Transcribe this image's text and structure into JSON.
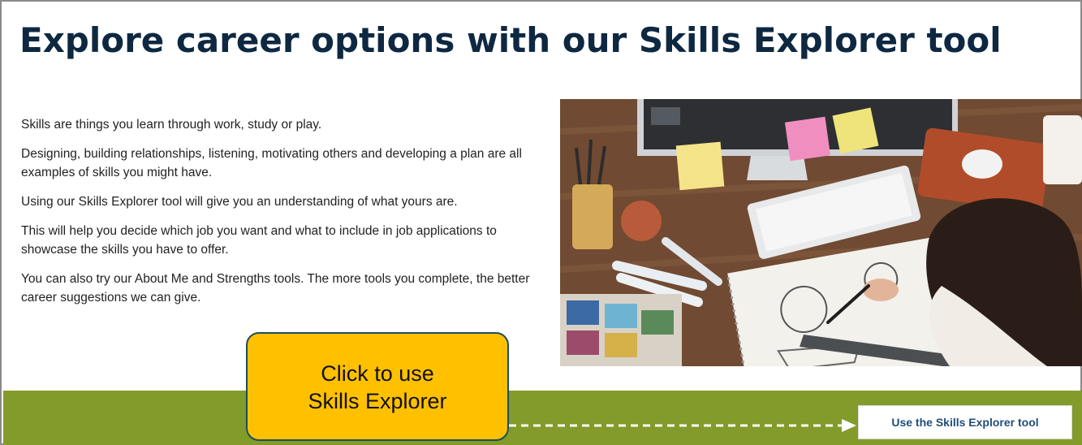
{
  "page": {
    "heading": "Explore career options with our Skills Explorer tool",
    "paragraphs": [
      "Skills are things you learn through work, study or play.",
      "Designing, building relationships, listening, motivating others and developing a plan are all examples of skills you might have.",
      "Using our Skills Explorer tool will give you an understanding of what yours are.",
      "This will help you decide which job you want and what to include in job applications to showcase the skills you have to offer.",
      "You can also try our About Me and Strengths tools. The more tools you complete, the better career suggestions we can give."
    ]
  },
  "image": {
    "subject": "person sketching designs at a wooden desk with keyboard, monitor, sticky notes and art supplies"
  },
  "callout": {
    "text": "Click to use\nSkills Explorer"
  },
  "cta": {
    "label": "Use the Skills Explorer tool"
  },
  "colors": {
    "heading": "#0e2841",
    "green_bar": "#839b2a",
    "callout_fill": "#ffc000",
    "callout_border": "#1e4d5b",
    "cta_text": "#1f4e79"
  }
}
